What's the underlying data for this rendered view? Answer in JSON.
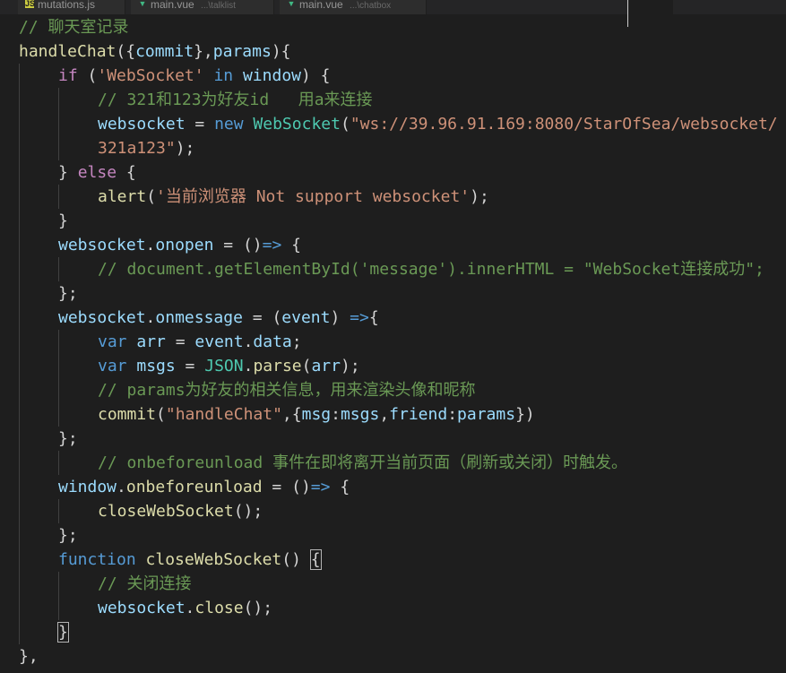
{
  "colors": {
    "background": "#1e1e1e",
    "comment": "#6a9955",
    "keyword": "#c586c0",
    "storage": "#569cd6",
    "variable": "#9cdcfe",
    "function": "#dcdcaa",
    "string": "#ce9178",
    "class": "#4ec9b0",
    "punctuation": "#d4d4d4"
  },
  "tabs": [
    {
      "label": "mutations.js",
      "description": "",
      "icon": "js-file-icon"
    },
    {
      "label": "main.vue",
      "description": "...\\talklist",
      "icon": "vue-file-icon"
    },
    {
      "label": "main.vue",
      "description": "...\\chatbox",
      "icon": "vue-file-icon"
    }
  ],
  "code": [
    {
      "indent": 0,
      "tokens": [
        {
          "t": "// 聊天室记录",
          "c": "comment"
        }
      ]
    },
    {
      "indent": 0,
      "tokens": [
        {
          "t": "handleChat",
          "c": "function"
        },
        {
          "t": "({",
          "c": "punct"
        },
        {
          "t": "commit",
          "c": "variable"
        },
        {
          "t": "},",
          "c": "punct"
        },
        {
          "t": "params",
          "c": "variable"
        },
        {
          "t": "){",
          "c": "punct"
        }
      ]
    },
    {
      "indent": 1,
      "tokens": [
        {
          "t": "if",
          "c": "keyword"
        },
        {
          "t": " (",
          "c": "punct"
        },
        {
          "t": "'WebSocket'",
          "c": "string"
        },
        {
          "t": " ",
          "c": "punct"
        },
        {
          "t": "in",
          "c": "storage"
        },
        {
          "t": " ",
          "c": "punct"
        },
        {
          "t": "window",
          "c": "variable"
        },
        {
          "t": ") {",
          "c": "punct"
        }
      ]
    },
    {
      "indent": 2,
      "tokens": [
        {
          "t": "// 321和123为好友id   用a来连接",
          "c": "comment"
        }
      ]
    },
    {
      "indent": 2,
      "tokens": [
        {
          "t": "websocket",
          "c": "variable"
        },
        {
          "t": " = ",
          "c": "operator"
        },
        {
          "t": "new",
          "c": "storage"
        },
        {
          "t": " ",
          "c": "punct"
        },
        {
          "t": "WebSocket",
          "c": "class"
        },
        {
          "t": "(",
          "c": "punct"
        },
        {
          "t": "\"ws://39.96.91.169:8080/StarOfSea/websocket/",
          "c": "string"
        }
      ]
    },
    {
      "indent": 2,
      "tokens": [
        {
          "t": "321a123\"",
          "c": "string"
        },
        {
          "t": ");",
          "c": "punct"
        }
      ]
    },
    {
      "indent": 1,
      "tokens": [
        {
          "t": "} ",
          "c": "punct"
        },
        {
          "t": "else",
          "c": "keyword"
        },
        {
          "t": " {",
          "c": "punct"
        }
      ]
    },
    {
      "indent": 2,
      "tokens": [
        {
          "t": "alert",
          "c": "function"
        },
        {
          "t": "(",
          "c": "punct"
        },
        {
          "t": "'当前浏览器 Not support websocket'",
          "c": "string"
        },
        {
          "t": ");",
          "c": "punct"
        }
      ]
    },
    {
      "indent": 1,
      "tokens": [
        {
          "t": "}",
          "c": "punct"
        }
      ]
    },
    {
      "indent": 1,
      "tokens": [
        {
          "t": "websocket",
          "c": "variable"
        },
        {
          "t": ".",
          "c": "punct"
        },
        {
          "t": "onopen",
          "c": "variable"
        },
        {
          "t": " = ",
          "c": "operator"
        },
        {
          "t": "()",
          "c": "punct"
        },
        {
          "t": "=>",
          "c": "storage"
        },
        {
          "t": " {",
          "c": "punct"
        }
      ]
    },
    {
      "indent": 2,
      "tokens": [
        {
          "t": "// document.getElementById('message').innerHTML = \"WebSocket连接成功\";",
          "c": "comment"
        }
      ]
    },
    {
      "indent": 1,
      "tokens": [
        {
          "t": "};",
          "c": "punct"
        }
      ]
    },
    {
      "indent": 1,
      "tokens": [
        {
          "t": "websocket",
          "c": "variable"
        },
        {
          "t": ".",
          "c": "punct"
        },
        {
          "t": "onmessage",
          "c": "variable"
        },
        {
          "t": " = (",
          "c": "operator"
        },
        {
          "t": "event",
          "c": "variable"
        },
        {
          "t": ") ",
          "c": "punct"
        },
        {
          "t": "=>",
          "c": "storage"
        },
        {
          "t": "{",
          "c": "punct"
        }
      ]
    },
    {
      "indent": 2,
      "tokens": [
        {
          "t": "var",
          "c": "storage"
        },
        {
          "t": " ",
          "c": "punct"
        },
        {
          "t": "arr",
          "c": "variable"
        },
        {
          "t": " = ",
          "c": "operator"
        },
        {
          "t": "event",
          "c": "variable"
        },
        {
          "t": ".",
          "c": "punct"
        },
        {
          "t": "data",
          "c": "variable"
        },
        {
          "t": ";",
          "c": "punct"
        }
      ]
    },
    {
      "indent": 2,
      "tokens": [
        {
          "t": "var",
          "c": "storage"
        },
        {
          "t": " ",
          "c": "punct"
        },
        {
          "t": "msgs",
          "c": "variable"
        },
        {
          "t": " = ",
          "c": "operator"
        },
        {
          "t": "JSON",
          "c": "class"
        },
        {
          "t": ".",
          "c": "punct"
        },
        {
          "t": "parse",
          "c": "function"
        },
        {
          "t": "(",
          "c": "punct"
        },
        {
          "t": "arr",
          "c": "variable"
        },
        {
          "t": ");",
          "c": "punct"
        }
      ]
    },
    {
      "indent": 2,
      "tokens": [
        {
          "t": "// params为好友的相关信息，用来渲染头像和昵称",
          "c": "comment"
        }
      ]
    },
    {
      "indent": 2,
      "tokens": [
        {
          "t": "commit",
          "c": "function"
        },
        {
          "t": "(",
          "c": "punct"
        },
        {
          "t": "\"handleChat\"",
          "c": "string"
        },
        {
          "t": ",{",
          "c": "punct"
        },
        {
          "t": "msg",
          "c": "variable"
        },
        {
          "t": ":",
          "c": "punct"
        },
        {
          "t": "msgs",
          "c": "variable"
        },
        {
          "t": ",",
          "c": "punct"
        },
        {
          "t": "friend",
          "c": "variable"
        },
        {
          "t": ":",
          "c": "punct"
        },
        {
          "t": "params",
          "c": "variable"
        },
        {
          "t": "})",
          "c": "punct"
        }
      ]
    },
    {
      "indent": 1,
      "tokens": [
        {
          "t": "};",
          "c": "punct"
        }
      ]
    },
    {
      "indent": 2,
      "tokens": [
        {
          "t": "// onbeforeunload 事件在即将离开当前页面（刷新或关闭）时触发。",
          "c": "comment"
        }
      ]
    },
    {
      "indent": 1,
      "tokens": [
        {
          "t": "window",
          "c": "variable"
        },
        {
          "t": ".",
          "c": "punct"
        },
        {
          "t": "onbeforeunload",
          "c": "function"
        },
        {
          "t": " = ",
          "c": "operator"
        },
        {
          "t": "()",
          "c": "punct"
        },
        {
          "t": "=>",
          "c": "storage"
        },
        {
          "t": " {",
          "c": "punct"
        }
      ]
    },
    {
      "indent": 2,
      "tokens": [
        {
          "t": "closeWebSocket",
          "c": "function"
        },
        {
          "t": "();",
          "c": "punct"
        }
      ]
    },
    {
      "indent": 1,
      "tokens": [
        {
          "t": "};",
          "c": "punct"
        }
      ]
    },
    {
      "indent": 1,
      "tokens": [
        {
          "t": "function",
          "c": "storage"
        },
        {
          "t": " ",
          "c": "punct"
        },
        {
          "t": "closeWebSocket",
          "c": "function"
        },
        {
          "t": "() ",
          "c": "punct"
        },
        {
          "t": "{",
          "c": "punct",
          "match": true
        }
      ]
    },
    {
      "indent": 2,
      "tokens": [
        {
          "t": "// 关闭连接",
          "c": "comment"
        }
      ]
    },
    {
      "indent": 2,
      "tokens": [
        {
          "t": "websocket",
          "c": "variable"
        },
        {
          "t": ".",
          "c": "punct"
        },
        {
          "t": "close",
          "c": "function"
        },
        {
          "t": "();",
          "c": "punct"
        }
      ]
    },
    {
      "indent": 1,
      "tokens": [
        {
          "t": "}",
          "c": "punct",
          "match": true
        }
      ]
    },
    {
      "indent": 0,
      "tokens": [
        {
          "t": "},",
          "c": "punct"
        }
      ]
    }
  ]
}
